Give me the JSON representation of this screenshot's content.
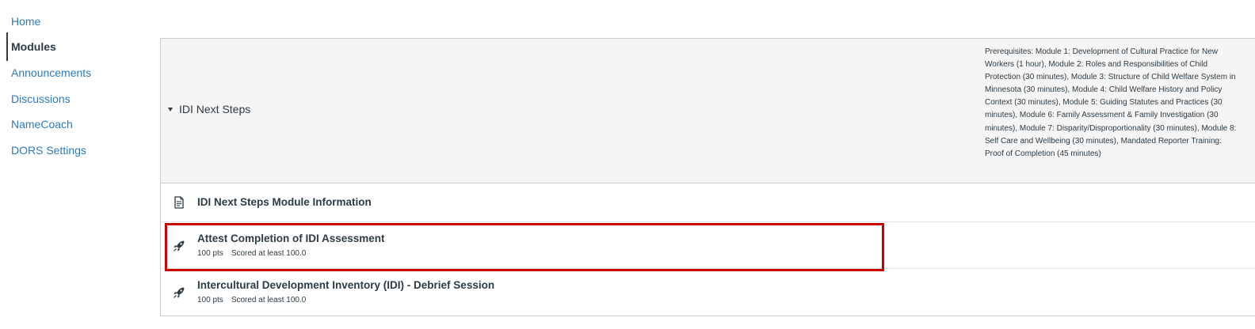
{
  "course_nav": {
    "items": [
      {
        "label": "Home",
        "active": false
      },
      {
        "label": "Modules",
        "active": true
      },
      {
        "label": "Announcements",
        "active": false
      },
      {
        "label": "Discussions",
        "active": false
      },
      {
        "label": "NameCoach",
        "active": false
      },
      {
        "label": "DORS Settings",
        "active": false
      }
    ]
  },
  "module": {
    "title": "IDI Next Steps",
    "prerequisites": "Prerequisites: Module 1: Development of Cultural Practice for New Workers (1 hour), Module 2: Roles and Responsibilities of Child Protection (30 minutes), Module 3: Structure of Child Welfare System in Minnesota (30 minutes), Module 4: Child Welfare History and Policy Context (30 minutes), Module 5: Guiding Statutes and Practices (30 minutes), Module 6: Family Assessment & Family Investigation (30 minutes), Module 7: Disparity/Disproportionality (30 minutes), Module 8: Self Care and Wellbeing (30 minutes), Mandated Reporter Training: Proof of Completion (45 minutes)",
    "items": [
      {
        "title": "IDI Next Steps Module Information",
        "icon": "page-icon",
        "points": "",
        "requirement": ""
      },
      {
        "title": "Attest Completion of IDI Assessment",
        "icon": "assignment-icon",
        "points": "100 pts",
        "requirement": "Scored at least 100.0"
      },
      {
        "title": "Intercultural Development Inventory (IDI) - Debrief Session",
        "icon": "assignment-icon",
        "points": "100 pts",
        "requirement": "Scored at least 100.0"
      }
    ]
  },
  "colors": {
    "link": "#2b7abc",
    "text": "#2d3b45",
    "header_bg": "#f5f5f5",
    "highlight": "#cc0000"
  }
}
